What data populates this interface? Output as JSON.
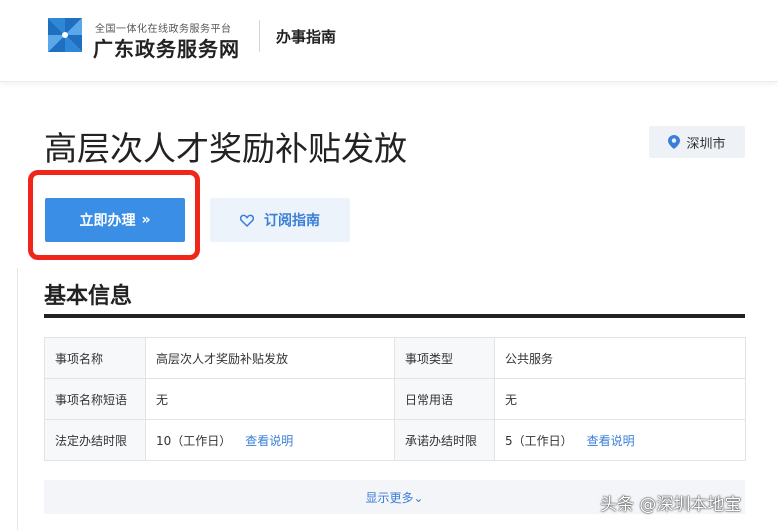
{
  "header": {
    "logo_subtitle": "全国一体化在线政务服务平台",
    "logo_title": "广东政务服务网",
    "section": "办事指南",
    "logo_icon": "pinwheel-icon"
  },
  "page": {
    "title": "高层次人才奖励补贴发放",
    "location": "深圳市",
    "location_icon": "map-pin-icon"
  },
  "buttons": {
    "apply": "立即办理",
    "apply_icon": "double-chevron-right-icon",
    "subscribe": "订阅指南",
    "subscribe_icon": "heart-icon"
  },
  "basic_info": {
    "title": "基本信息",
    "rows": [
      {
        "label1": "事项名称",
        "value1": "高层次人才奖励补贴发放",
        "label2": "事项类型",
        "value2": "公共服务"
      },
      {
        "label1": "事项名称短语",
        "value1": "无",
        "label2": "日常用语",
        "value2": "无"
      },
      {
        "label1": "法定办结时限",
        "value1": "10（工作日）",
        "link1": "查看说明",
        "label2": "承诺办结时限",
        "value2": "5（工作日）",
        "link2": "查看说明"
      }
    ],
    "show_more": "显示更多"
  },
  "watermark": "头条 @深圳本地宝",
  "colors": {
    "primary": "#3a8ee6",
    "highlight_frame": "#f0261b",
    "link": "#3a7fd6"
  }
}
